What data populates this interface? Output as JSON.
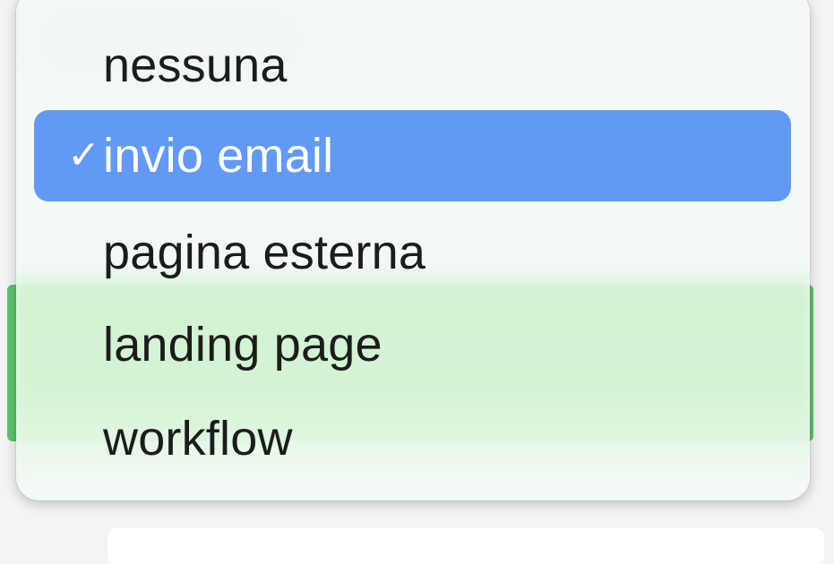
{
  "menu": {
    "items": [
      {
        "label": "nessuna",
        "selected": false
      },
      {
        "label": "invio email",
        "selected": true
      },
      {
        "label": "pagina esterna",
        "selected": false
      },
      {
        "label": "landing page",
        "selected": false
      },
      {
        "label": "workflow",
        "selected": false
      }
    ],
    "check_glyph": "✓",
    "colors": {
      "selected_background": "#6199f5",
      "selected_text": "#ffffff",
      "text": "#1c1c1c"
    }
  }
}
